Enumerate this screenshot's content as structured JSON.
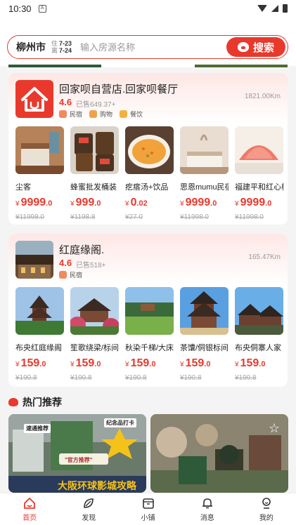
{
  "status_bar": {
    "time": "10:30",
    "notification_icon": "A"
  },
  "search": {
    "city": "柳州市",
    "checkin_label": "住",
    "checkin_date": "7-23",
    "checkout_label": "离",
    "checkout_date": "7-24",
    "placeholder": "输入房源名称",
    "button_label": "搜索"
  },
  "shops": [
    {
      "name": "回家呗自营店.回家呗餐厅",
      "rating": "4.6",
      "sold": "已售649.37+",
      "distance": "1821.00Km",
      "tags": [
        "民宿",
        "购物",
        "餐饮"
      ],
      "items": [
        {
          "title": "尘客",
          "currency": "¥",
          "price_int": "9999",
          "price_dec": ".0",
          "orig": "¥11998.0"
        },
        {
          "title": "蜂蜜批发桶装",
          "currency": "¥",
          "price_int": "999",
          "price_dec": ".0",
          "orig": "¥1198.8"
        },
        {
          "title": "疙瘩汤+饮品",
          "currency": "¥",
          "price_int": "0",
          "price_dec": ".02",
          "orig": "¥27.0"
        },
        {
          "title": "思恩mumu民宿",
          "currency": "¥",
          "price_int": "9999",
          "price_dec": ".0",
          "orig": "¥11998.0"
        },
        {
          "title": "福建平和红心柚",
          "currency": "¥",
          "price_int": "9999",
          "price_dec": ".0",
          "orig": "¥11998.0"
        }
      ]
    },
    {
      "name": "红庭缘阁.",
      "rating": "4.6",
      "sold": "已售518+",
      "distance": "165.47Km",
      "tags": [
        "民宿"
      ],
      "items": [
        {
          "title": "布央红庭缘阁",
          "currency": "¥",
          "price_int": "159",
          "price_dec": ".0",
          "orig": "¥190.8"
        },
        {
          "title": "笙歌绕梁/标间",
          "currency": "¥",
          "price_int": "159",
          "price_dec": ".0",
          "orig": "¥190.8"
        },
        {
          "title": "秋染千梯/大床",
          "currency": "¥",
          "price_int": "159",
          "price_dec": ".0",
          "orig": "¥190.8"
        },
        {
          "title": "茶馕/侗银标间",
          "currency": "¥",
          "price_int": "159",
          "price_dec": ".0",
          "orig": "¥190.8"
        },
        {
          "title": "布央侗寨人家",
          "currency": "¥",
          "price_int": "159",
          "price_dec": ".0",
          "orig": "¥190.8"
        }
      ]
    }
  ],
  "hot": {
    "title": "热门推荐",
    "left_badges": [
      "速通推荐",
      "纪念品打卡",
      "\"官方推荐\"",
      "大阪环球影城攻略"
    ]
  },
  "nav": [
    {
      "label": "首页",
      "icon": "home-icon",
      "active": true
    },
    {
      "label": "发现",
      "icon": "discover-icon",
      "active": false
    },
    {
      "label": "小铺",
      "icon": "shop-icon",
      "active": false
    },
    {
      "label": "消息",
      "icon": "bell-icon",
      "active": false
    },
    {
      "label": "我的",
      "icon": "profile-icon",
      "active": false
    }
  ],
  "colors": {
    "accent": "#e9392d",
    "tag_homestay": "#f08a5d",
    "tag_shopping": "#f2a14a",
    "tag_food": "#f5b13d"
  }
}
